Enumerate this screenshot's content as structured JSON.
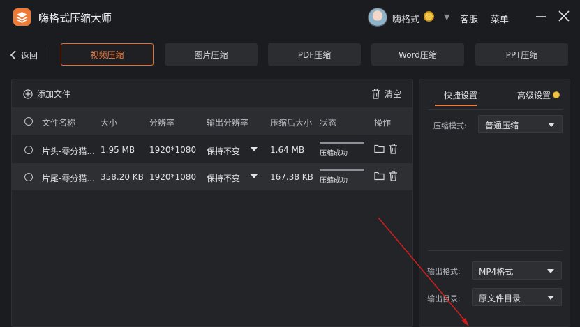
{
  "app": {
    "title": "嗨格式压缩大师",
    "username": "嗨格式",
    "links": [
      "客服",
      "菜单"
    ],
    "accent": "#ef7d43"
  },
  "nav": {
    "back_label": "返回",
    "tabs": [
      "视频压缩",
      "图片压缩",
      "PDF压缩",
      "Word压缩",
      "PPT压缩"
    ],
    "active_tab": "视频压缩"
  },
  "toolbar": {
    "add_file": "添加文件",
    "clear": "清空"
  },
  "table": {
    "headers": [
      "文件名称",
      "大小",
      "分辨率",
      "输出分辨率",
      "压缩后大小",
      "状态",
      "操作"
    ],
    "rows": [
      {
        "name": "片头-零分猫...",
        "size": "1.95 MB",
        "resolution": "1920*1080",
        "output_resolution": "保持不变",
        "compressed_size": "1.64 MB",
        "status": "压缩成功"
      },
      {
        "name": "片尾-零分猫...",
        "size": "358.20 KB",
        "resolution": "1920*1080",
        "output_resolution": "保持不变",
        "compressed_size": "167.38 KB",
        "status": "压缩成功"
      }
    ]
  },
  "settings": {
    "tabs": [
      "快捷设置",
      "高级设置"
    ],
    "mode_label": "压缩模式:",
    "mode_value": "普通压缩",
    "format_label": "输出格式:",
    "format_value": "MP4格式",
    "dir_label": "输出目录:",
    "dir_value": "原文件目录"
  },
  "icons": [
    "app-logo-icon",
    "coin-icon",
    "chevron-down-icon",
    "minimize-icon",
    "close-icon",
    "chevron-left-icon",
    "plus-circle-icon",
    "trash-icon",
    "folder-icon",
    "radio-icon",
    "annotation-arrow"
  ]
}
